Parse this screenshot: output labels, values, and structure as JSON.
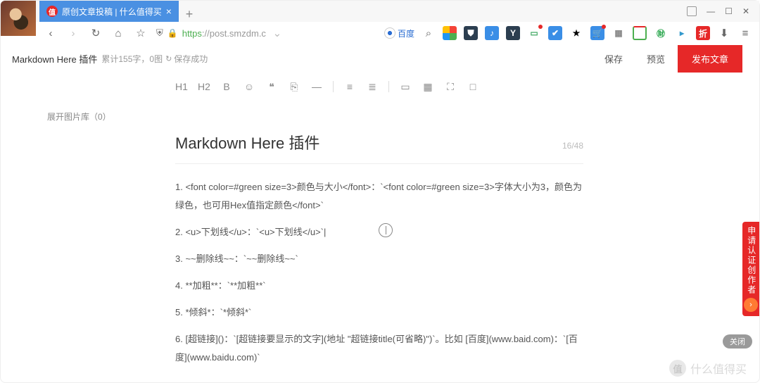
{
  "browser": {
    "tab": {
      "favicon_text": "值",
      "title": "原创文章投稿 | 什么值得买"
    },
    "newtab": "+",
    "win": {
      "min": "—",
      "max": "☐",
      "close": "✕"
    },
    "url_green": "https",
    "url_rest": "://post.smzdm.c",
    "baidu_label": "百度"
  },
  "page": {
    "doc_title": "Markdown Here 插件",
    "stats": "累计155字，0图",
    "save_status": "保存成功",
    "save_btn": "保存",
    "preview_btn": "预览",
    "publish_btn": "发布文章",
    "gallery_btn": "展开图片库（0）",
    "toolbar": [
      "H1",
      "H2",
      "B",
      "☺",
      "❝",
      "⎘",
      "—",
      "",
      "≡",
      "≣",
      "",
      "▭",
      "▦",
      "⛶",
      "□"
    ]
  },
  "editor": {
    "title": "Markdown Here 插件",
    "counter": "16/48",
    "lines": [
      "1.  <font color=#green size=3>颜色与大小</font>：`<font color=#green size=3>字体大小为3，颜色为绿色，也可用Hex值指定颜色</font>`",
      "2. <u>下划线</u>：`<u>下划线</u>`|",
      "3. ~~删除线~~：`~~删除线~~`",
      "4. **加粗**：`**加粗**`",
      "5. *倾斜*：`*倾斜*`",
      "6. [超链接]()：`[超链接要显示的文字](地址 \"超链接title(可省略)\")`。比如 [百度](www.baid.com)：`[百度](www.baidu.com)`"
    ]
  },
  "side": {
    "apply": "申请认证创作者",
    "close": "关闭"
  },
  "watermark": "什么值得买"
}
